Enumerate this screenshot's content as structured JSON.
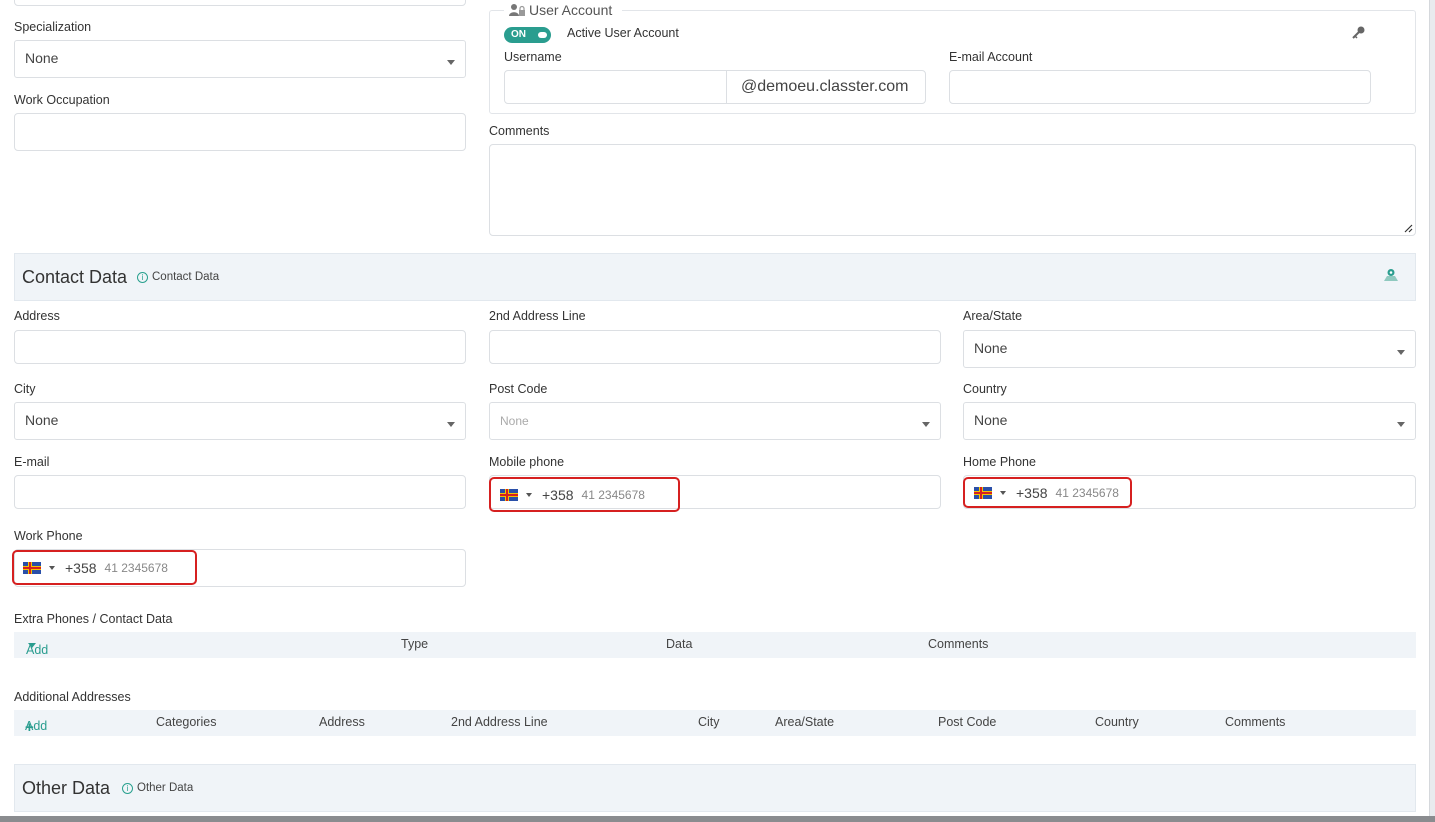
{
  "left_form": {
    "specialization": {
      "label": "Specialization",
      "value": "None"
    },
    "work_occupation": {
      "label": "Work Occupation",
      "value": ""
    }
  },
  "user_account": {
    "legend": "User Account",
    "toggle_label": "ON",
    "active_label": "Active User Account",
    "username_label": "Username",
    "username_value": "",
    "domain_suffix": "@demoeu.classter.com",
    "email_label": "E-mail Account",
    "email_value": ""
  },
  "comments": {
    "label": "Comments",
    "value": ""
  },
  "contact_section": {
    "title": "Contact Data",
    "info": "Contact Data",
    "fields": {
      "address": {
        "label": "Address",
        "value": ""
      },
      "address2": {
        "label": "2nd Address Line",
        "value": ""
      },
      "area_state": {
        "label": "Area/State",
        "value": "None"
      },
      "city": {
        "label": "City",
        "value": "None"
      },
      "post_code": {
        "label": "Post Code",
        "value": "None"
      },
      "country": {
        "label": "Country",
        "value": "None"
      },
      "email": {
        "label": "E-mail",
        "value": ""
      },
      "mobile_phone": {
        "label": "Mobile phone",
        "code": "+358",
        "placeholder": "41 2345678"
      },
      "home_phone": {
        "label": "Home Phone",
        "code": "+358",
        "placeholder": "41 2345678"
      },
      "work_phone": {
        "label": "Work Phone",
        "code": "+358",
        "placeholder": "41 2345678"
      }
    }
  },
  "extra_phones": {
    "label": "Extra Phones / Contact Data",
    "add_label": "Add",
    "columns": [
      "Type",
      "Data",
      "Comments"
    ]
  },
  "additional_addresses": {
    "label": "Additional Addresses",
    "add_label": "Add",
    "columns": [
      "Categories",
      "Address",
      "2nd Address Line",
      "City",
      "Area/State",
      "Post Code",
      "Country",
      "Comments"
    ]
  },
  "other_section": {
    "title": "Other Data",
    "info": "Other Data"
  },
  "colors": {
    "accent": "#2a9d8f",
    "highlight": "#d62020",
    "section_bg": "#f0f4f8"
  }
}
